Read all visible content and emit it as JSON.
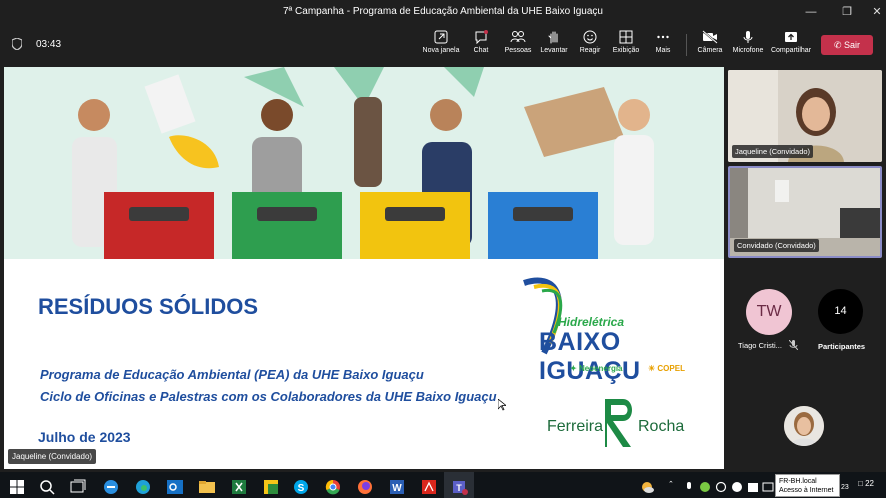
{
  "window": {
    "title": "7ª Campanha - Programa de Educação Ambiental da UHE Baixo Iguaçu",
    "controls": [
      "minimize-icon",
      "maximize-icon",
      "close-icon"
    ]
  },
  "meeting": {
    "timer": "03:43",
    "toolbar": [
      {
        "key": "new_window",
        "label": "Nova janela",
        "icon": "new-window-icon"
      },
      {
        "key": "chat",
        "label": "Chat",
        "icon": "chat-icon"
      },
      {
        "key": "people",
        "label": "Pessoas",
        "icon": "people-icon"
      },
      {
        "key": "raise",
        "label": "Levantar",
        "icon": "raise-hand-icon"
      },
      {
        "key": "react",
        "label": "Reagir",
        "icon": "react-icon"
      },
      {
        "key": "view",
        "label": "Exibição",
        "icon": "view-icon"
      },
      {
        "key": "more",
        "label": "Mais",
        "icon": "more-icon"
      },
      {
        "key": "camera",
        "label": "Câmera",
        "icon": "camera-icon"
      },
      {
        "key": "mic",
        "label": "Microfone",
        "icon": "mic-icon"
      },
      {
        "key": "share",
        "label": "Compartilhar",
        "icon": "share-icon"
      }
    ],
    "leave_label": "Sair"
  },
  "slide": {
    "title": "RESÍDUOS SÓLIDOS",
    "line1": "Programa de Educação Ambiental (PEA) da UHE Baixo Iguaçu",
    "line2": "Ciclo de Oficinas e Palestras com os Colaboradores da UHE Baixo Iguaçu",
    "date": "Julho de 2023",
    "logo_small": "Hidrelétrica",
    "logo_big": "BAIXO IGUAÇU",
    "partner1": "Neoenergia",
    "partner2": "COPEL",
    "brand_left": "Ferreira",
    "brand_right": "Rocha",
    "bin_colors": [
      "#c62828",
      "#2e9e4f",
      "#f2c40f",
      "#2a7fd4"
    ]
  },
  "presenter_tag": "Jaqueline (Convidado)",
  "participants": {
    "tile1_name": "Jaqueline (Convidado)",
    "tile2_name": "Convidado (Convidado)",
    "tw_initials": "TW",
    "tw_name": "Tiago Cristi...",
    "count": "14",
    "count_label": "Participantes"
  },
  "taskbar": {
    "tooltip_line1": "FR-BH.local",
    "tooltip_line2": "Acesso à Internet",
    "clock_fragment": "23",
    "notification_count": "22"
  }
}
